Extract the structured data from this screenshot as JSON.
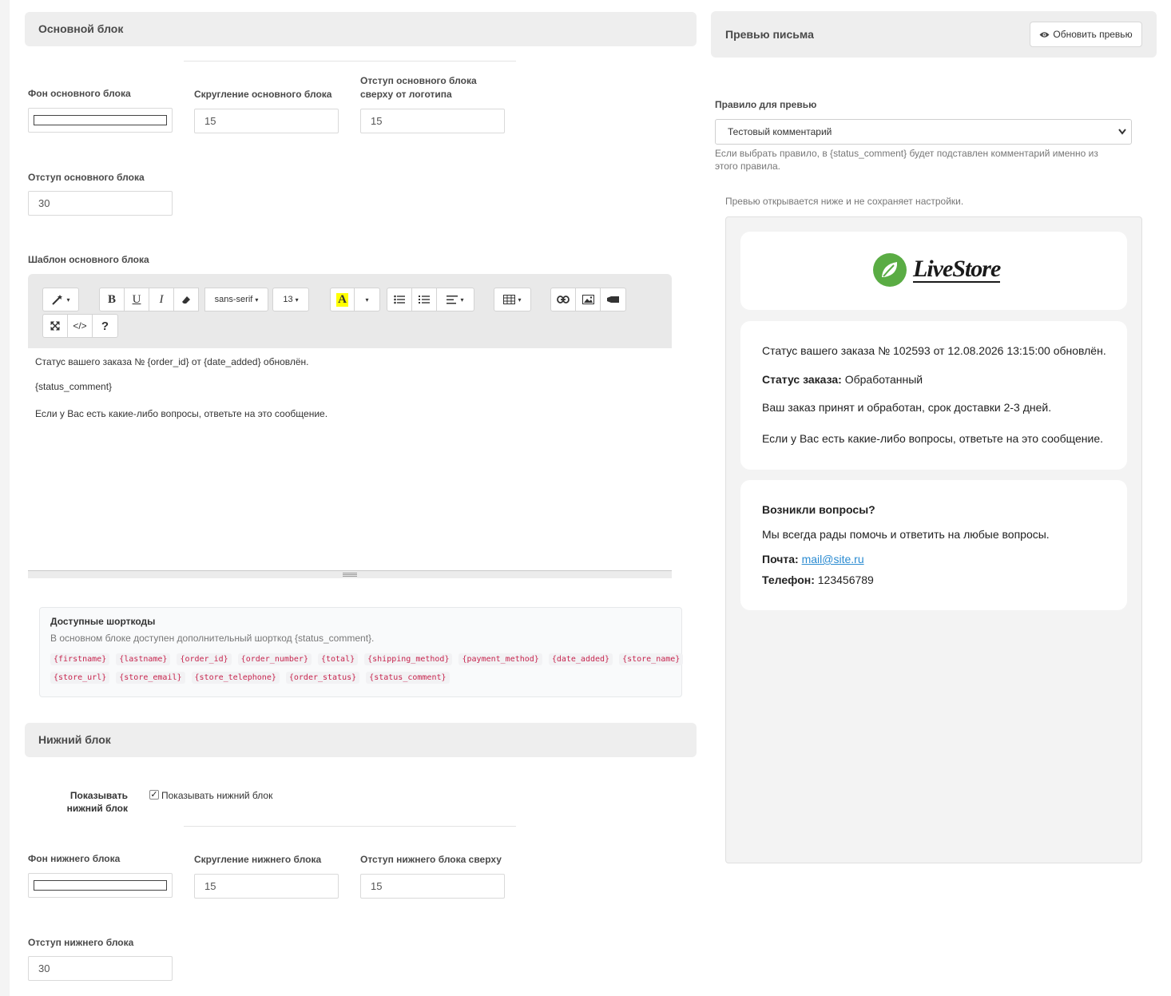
{
  "main_block": {
    "header": "Основной блок",
    "bg_label": "Фон основного блока",
    "radius_label": "Скругление основного блока",
    "radius_value": "15",
    "offset_top_label_line1": "Отступ основного блока",
    "offset_top_label_line2": "сверху от логотипа",
    "offset_top_value": "15",
    "padding_label": "Отступ основного блока",
    "padding_value": "30",
    "template_label": "Шаблон основного блока",
    "bg_color": "#ffffff"
  },
  "toolbar": {
    "magic_icon": "magic-wand-icon",
    "bold": "B",
    "underline": "U",
    "italic": "I",
    "eraser_icon": "eraser-icon",
    "font_family": "sans-serif",
    "font_size": "13",
    "highlight": "A",
    "code_view": "</>",
    "help": "?"
  },
  "editor": {
    "line1": "Статус вашего заказа № {order_id} от {date_added} обновлён.",
    "line2": "{status_comment}",
    "line3": "Если у Вас есть какие-либо вопросы, ответьте на это сообщение."
  },
  "shortcodes": {
    "title": "Доступные шорткоды",
    "description": "В основном блоке доступен дополнительный шорткод {status_comment}.",
    "row1": [
      "{firstname}",
      "{lastname}",
      "{order_id}",
      "{order_number}",
      "{total}",
      "{shipping_method}",
      "{payment_method}",
      "{date_added}",
      "{store_name}"
    ],
    "row2": [
      "{store_url}",
      "{store_email}",
      "{store_telephone}",
      "{order_status}",
      "{status_comment}"
    ]
  },
  "bottom_block": {
    "header": "Нижний блок",
    "show_label_line1": "Показывать",
    "show_label_line2": "нижний блок",
    "show_checkbox_text": "Показывать нижний блок",
    "show_checked": true,
    "bg_label": "Фон нижнего блока",
    "radius_label": "Скругление нижнего блока",
    "radius_value": "15",
    "offset_top_label": "Отступ нижнего блока сверху",
    "offset_top_value": "15",
    "padding_label": "Отступ нижнего блока",
    "padding_value": "30"
  },
  "preview": {
    "header": "Превью письма",
    "refresh_button": "Обновить превью",
    "rule_label": "Правило для превью",
    "rule_selected": "Тестовый комментарий",
    "rule_help": "Если выбрать правило, в {status_comment} будет подставлен комментарий именно из этого правила.",
    "note": "Превью открывается ниже и не сохраняет настройки.",
    "logo_text": "LiveStore",
    "status_line": "Статус вашего заказа № 102593 от 12.08.2026 13:15:00 обновлён.",
    "status_label": "Статус заказа:",
    "status_value": "Обработанный",
    "comment": "Ваш заказ принят и обработан, срок доставки 2-3 дней.",
    "questions": "Если у Вас есть какие-либо вопросы, ответьте на это сообщение.",
    "footer_title": "Возникли вопросы?",
    "footer_text": "Мы всегда рады помочь и ответить на любые вопросы.",
    "mail_label": "Почта:",
    "mail_value": "mail@site.ru",
    "phone_label": "Телефон:",
    "phone_value": "123456789",
    "logo_color": "#5aac44"
  }
}
